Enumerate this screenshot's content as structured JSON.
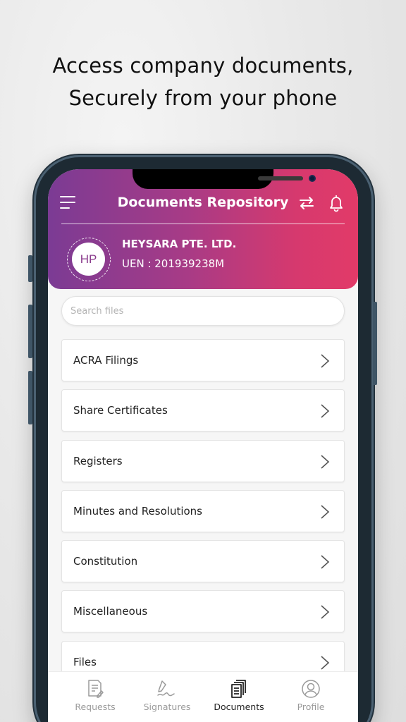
{
  "tagline": {
    "line1": "Access company documents,",
    "line2": "Securely from your phone"
  },
  "header": {
    "title": "Documents Repository",
    "menu_icon": "hamburger-menu-icon",
    "sync_icon": "sync-arrows-icon",
    "notification_icon": "bell-icon",
    "gradient_colors": [
      "#7b3b94",
      "#e23a68"
    ]
  },
  "company": {
    "initials": "HP",
    "name": "HEYSARA PTE. LTD.",
    "uen": "UEN : 201939238M"
  },
  "search": {
    "placeholder": "Search files",
    "value": ""
  },
  "folders": [
    {
      "label": "ACRA Filings"
    },
    {
      "label": "Share Certificates"
    },
    {
      "label": "Registers"
    },
    {
      "label": "Minutes and Resolutions"
    },
    {
      "label": "Constitution"
    },
    {
      "label": "Miscellaneous"
    },
    {
      "label": "Files"
    }
  ],
  "tabs": [
    {
      "label": "Requests",
      "icon": "request-form-icon",
      "active": false
    },
    {
      "label": "Signatures",
      "icon": "signature-pen-icon",
      "active": false
    },
    {
      "label": "Documents",
      "icon": "documents-stack-icon",
      "active": true
    },
    {
      "label": "Profile",
      "icon": "user-circle-icon",
      "active": false
    }
  ]
}
